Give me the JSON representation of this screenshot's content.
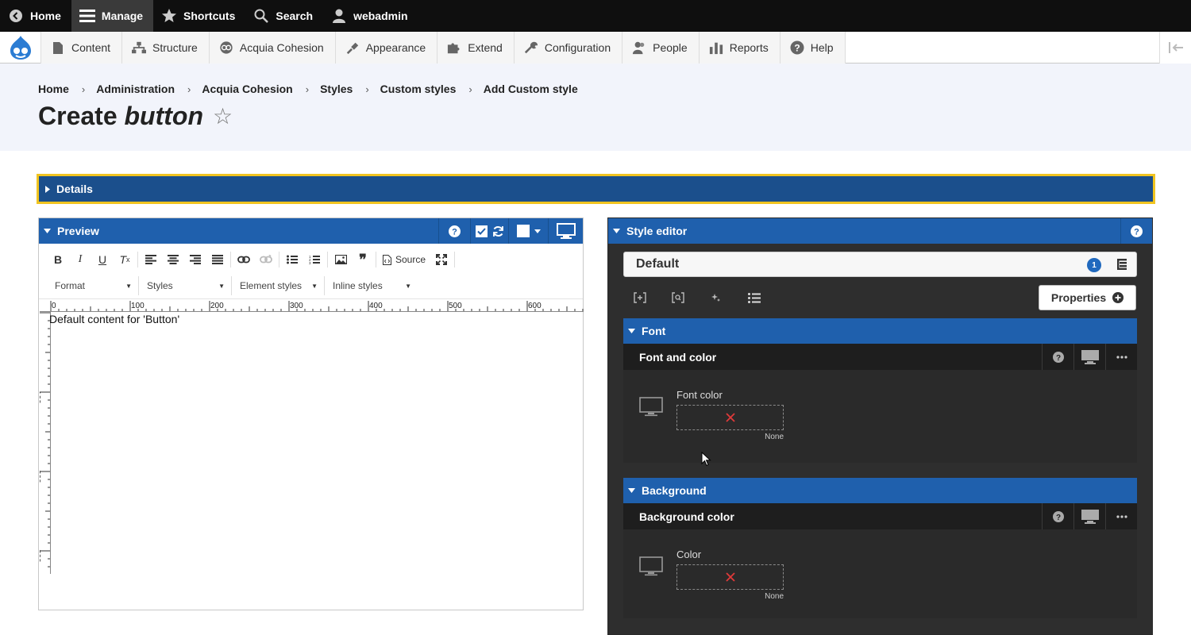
{
  "toolbar": {
    "home": "Home",
    "manage": "Manage",
    "shortcuts": "Shortcuts",
    "search": "Search",
    "user": "webadmin"
  },
  "tray": {
    "items": [
      "Content",
      "Structure",
      "Acquia Cohesion",
      "Appearance",
      "Extend",
      "Configuration",
      "People",
      "Reports",
      "Help"
    ]
  },
  "breadcrumb": [
    "Home",
    "Administration",
    "Acquia Cohesion",
    "Styles",
    "Custom styles",
    "Add Custom style"
  ],
  "page_title": {
    "prefix": "Create",
    "emphasis": "button"
  },
  "details": {
    "label": "Details"
  },
  "preview": {
    "label": "Preview",
    "source_label": "Source",
    "combos": [
      "Format",
      "Styles",
      "Element styles",
      "Inline styles"
    ],
    "ruler_h": [
      "0",
      "100",
      "200",
      "300",
      "400",
      "500",
      "600"
    ],
    "ruler_v": [
      "0",
      "100",
      "200",
      "300"
    ],
    "content": "Default content for 'Button'"
  },
  "style_editor": {
    "label": "Style editor",
    "selector": "Default",
    "badge": "1",
    "properties_label": "Properties",
    "sections": [
      {
        "title": "Font",
        "subtitle": "Font and color",
        "field_label": "Font color",
        "value_label": "None"
      },
      {
        "title": "Background",
        "subtitle": "Background color",
        "field_label": "Color",
        "value_label": "None"
      }
    ]
  },
  "colors": {
    "toolbar_bg": "#0f0f0f",
    "accent_blue": "#1f60ad",
    "details_bg": "#1b4f8c",
    "details_border": "#f0c420",
    "editor_bg": "#2e2e2e",
    "clear_x": "#e03a3a"
  }
}
